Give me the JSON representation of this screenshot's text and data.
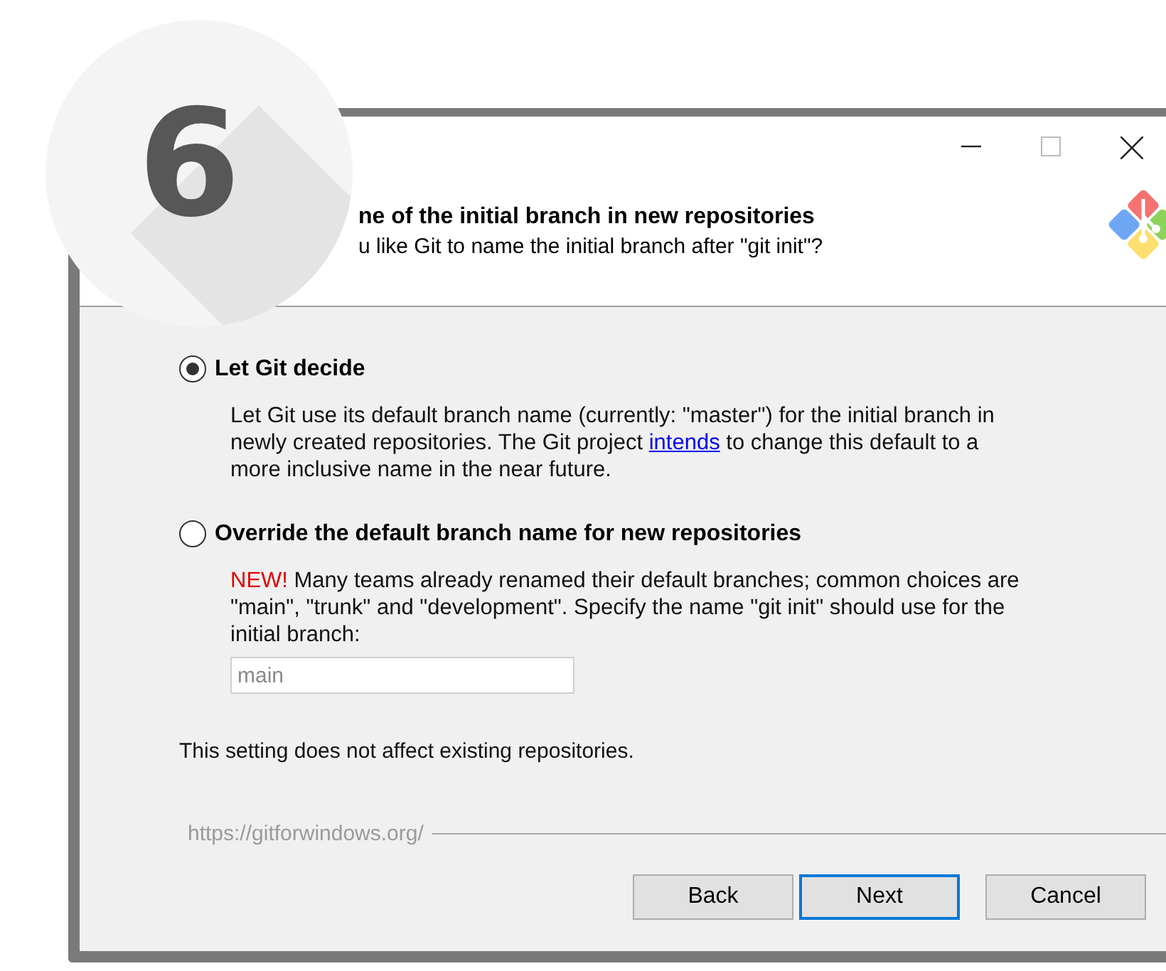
{
  "step": {
    "number": "6"
  },
  "header": {
    "title": "ne of the initial branch in new repositories",
    "subtitle": "u like Git to name the initial branch after \"git init\"?"
  },
  "options": [
    {
      "label": "Let Git decide",
      "selected": true,
      "text_before": "Let Git use its default branch name (currently: \"master\") for the initial branch in newly created repositories. The Git project ",
      "link": "intends",
      "text_after": " to change this default to a more inclusive name in the near future."
    },
    {
      "label": "Override the default branch name for new repositories",
      "selected": false,
      "flag": "NEW!",
      "text_before": " Many teams already renamed their default branches; common choices are \"main\", \"trunk\" and \"development\". Specify the name \"git init\" should use for the initial branch:",
      "field": {
        "placeholder": "main",
        "disabled": true
      }
    }
  ],
  "note": "This setting does not affect existing repositories.",
  "footer": {
    "url": "https://gitforwindows.org/",
    "buttons": [
      {
        "label": "Back",
        "default": false
      },
      {
        "label": "Next",
        "default": true
      },
      {
        "label": "Cancel",
        "default": false
      }
    ]
  }
}
